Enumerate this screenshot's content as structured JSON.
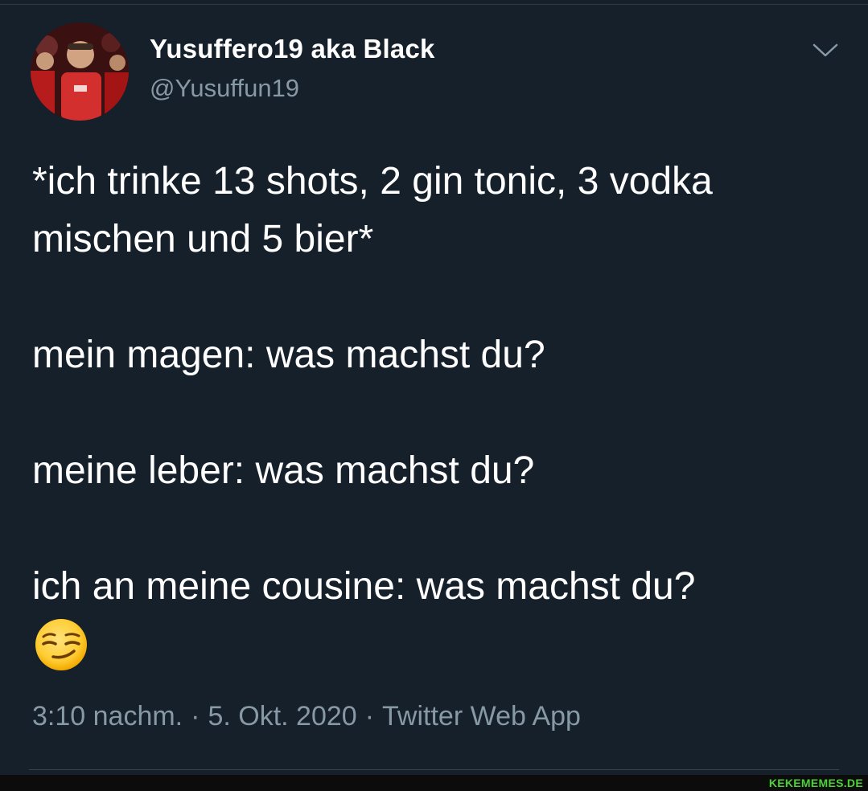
{
  "tweet": {
    "display_name": "Yusuffero19 aka Black",
    "handle": "@Yusuffun19",
    "lines": [
      "*ich trinke 13 shots, 2 gin tonic, 3 vodka mischen und 5 bier*",
      "mein magen: was machst du?",
      "meine leber: was machst du?",
      "ich an meine cousine: was machst du?"
    ],
    "emoji": "smirking-face",
    "time": "3:10 nachm.",
    "separator": "·",
    "date": "5. Okt. 2020",
    "source": "Twitter Web App"
  },
  "watermark": "KEKEMEMES.DE",
  "colors": {
    "background": "#15202b",
    "text": "#ffffff",
    "muted": "#8899a6",
    "watermark": "#4cd137"
  },
  "icons": {
    "more": "chevron-down-icon"
  }
}
